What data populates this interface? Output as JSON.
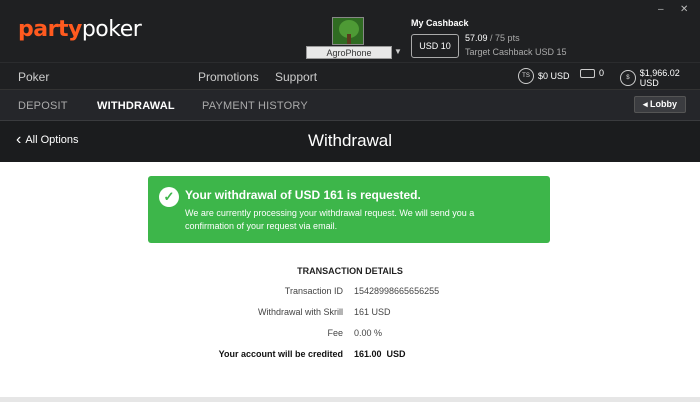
{
  "header": {
    "logo_prefix": "party",
    "logo_suffix": "poker",
    "window_minimize": "–",
    "window_close": "✕",
    "username": "AgroPhone",
    "cashback": {
      "title": "My Cashback",
      "button": "USD 10",
      "points": "57.09",
      "points_total": "/ 75 pts",
      "target": "Target Cashback USD 15"
    }
  },
  "nav": {
    "poker": "Poker",
    "promotions": "Promotions",
    "support": "Support",
    "ts_icon": "TS",
    "ts_balance": "$0 USD",
    "tickets": "0",
    "cash_icon": "$",
    "cash_balance": "$1,966.02 USD"
  },
  "tabs": {
    "deposit": "DEPOSIT",
    "withdrawal": "WITHDRAWAL",
    "payment_history": "PAYMENT HISTORY",
    "lobby": "Lobby"
  },
  "title_row": {
    "back": "All Options",
    "title": "Withdrawal"
  },
  "alert": {
    "headline": "Your withdrawal of USD 161 is requested.",
    "message": "We are currently processing your withdrawal request. We will send you a confirmation of your request via email.",
    "color": "#3db64a"
  },
  "transaction": {
    "title": "TRANSACTION DETAILS",
    "rows": [
      {
        "label": "Transaction ID",
        "value": "15428998665656255"
      },
      {
        "label": "Withdrawal with Skrill",
        "value": "161 USD"
      },
      {
        "label": "Fee",
        "value": "0.00 %"
      },
      {
        "label": "Your account will be credited",
        "value": "161.00  USD"
      }
    ]
  },
  "colors": {
    "brand_orange": "#ff5a1f",
    "header_bg": "#1f2022",
    "success": "#3db64a"
  }
}
